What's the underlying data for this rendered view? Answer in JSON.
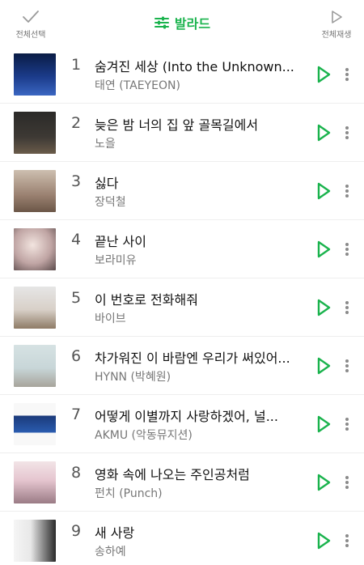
{
  "header": {
    "left_label": "전체선택",
    "title": "발라드",
    "right_label": "전체재생"
  },
  "songs": [
    {
      "rank": "1",
      "title": "숨겨진 세상 (Into the Unknown...",
      "artist": "태연 (TAEYEON)"
    },
    {
      "rank": "2",
      "title": "늦은 밤 너의 집 앞 골목길에서",
      "artist": "노을"
    },
    {
      "rank": "3",
      "title": "싫다",
      "artist": "장덕철"
    },
    {
      "rank": "4",
      "title": "끝난 사이",
      "artist": "보라미유"
    },
    {
      "rank": "5",
      "title": "이 번호로 전화해줘",
      "artist": "바이브"
    },
    {
      "rank": "6",
      "title": "차가워진 이 바람엔 우리가 써있어...",
      "artist": "HYNN (박혜원)"
    },
    {
      "rank": "7",
      "title": "어떻게 이별까지 사랑하겠어, 널...",
      "artist": "AKMU (악동뮤지션)"
    },
    {
      "rank": "8",
      "title": "영화 속에 나오는 주인공처럼",
      "artist": "펀치 (Punch)"
    },
    {
      "rank": "9",
      "title": "새 사랑",
      "artist": "송하예"
    }
  ],
  "colors": {
    "accent": "#1ab34d",
    "text_primary": "#111111",
    "text_secondary": "#777777",
    "divider": "#eeeeee"
  },
  "icons": {
    "select_all": "checkmark-icon",
    "title": "equalizer-icon",
    "play_all": "play-outline-icon",
    "row_play": "play-icon",
    "row_more": "more-vertical-icon"
  }
}
